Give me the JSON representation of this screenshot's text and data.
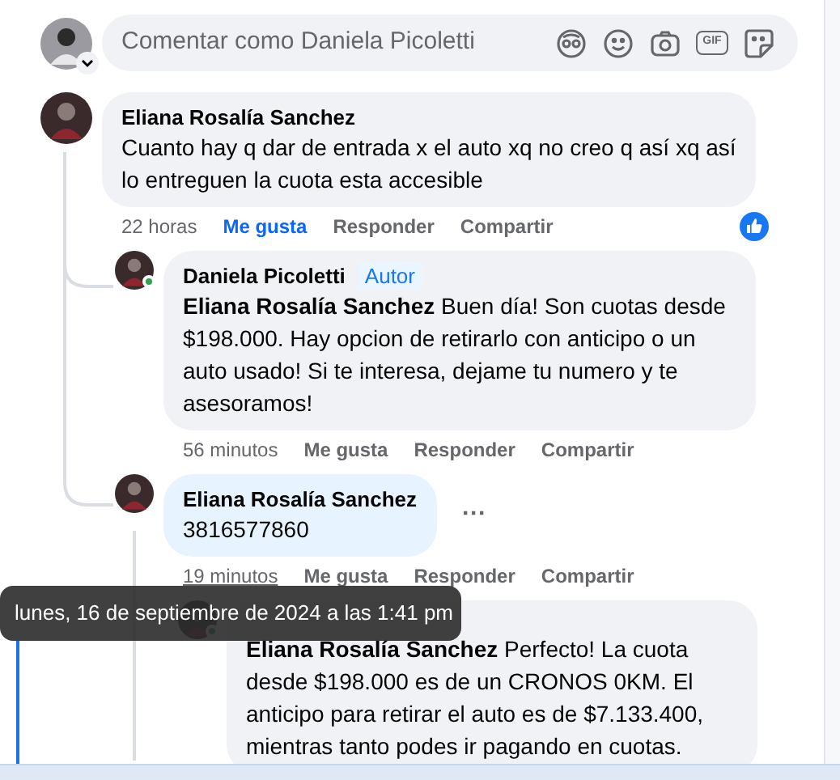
{
  "composer": {
    "placeholder": "Comentar como Daniela Picoletti",
    "gif_label": "GIF"
  },
  "comments": [
    {
      "author": "Eliana Rosalía Sanchez",
      "text": "Cuanto hay q dar de entrada x el auto xq no creo q así xq así lo entreguen la cuota esta accesible",
      "time": "22 horas",
      "actions": [
        "Me gusta",
        "Responder",
        "Compartir"
      ],
      "liked": true,
      "reacted": true,
      "children": [
        {
          "author": "Daniela Picoletti",
          "badge": "Autor",
          "text": "**Eliana Rosalía Sanchez** Buen día! Son cuotas desde $198.000. Hay opcion de retirarlo con anticipo o un auto usado! Si te interesa, dejame tu numero y te asesoramos!",
          "time": "56 minutos",
          "actions": [
            "Me gusta",
            "Responder",
            "Compartir"
          ],
          "liked": false,
          "online": true
        },
        {
          "author": "Eliana Rosalía Sanchez",
          "text": "3816577860",
          "menu": "···",
          "time": "19 minutos",
          "actions": [
            "Me gusta",
            "Responder",
            "Compartir"
          ],
          "liked": false,
          "highlighted": true,
          "time_hovered": true,
          "children": [
            {
              "text": "**Eliana Rosalía Sanchez** Perfecto! La cuota desde $198.000 es de un CRONOS 0KM. El anticipo para retirar el auto es de $7.133.400, mientras tanto podes ir pagando en cuotas.",
              "online": true
            }
          ]
        }
      ]
    }
  ],
  "tooltip": {
    "text": "lunes, 16 de septiembre de 2024 a las 1:41 pm"
  }
}
